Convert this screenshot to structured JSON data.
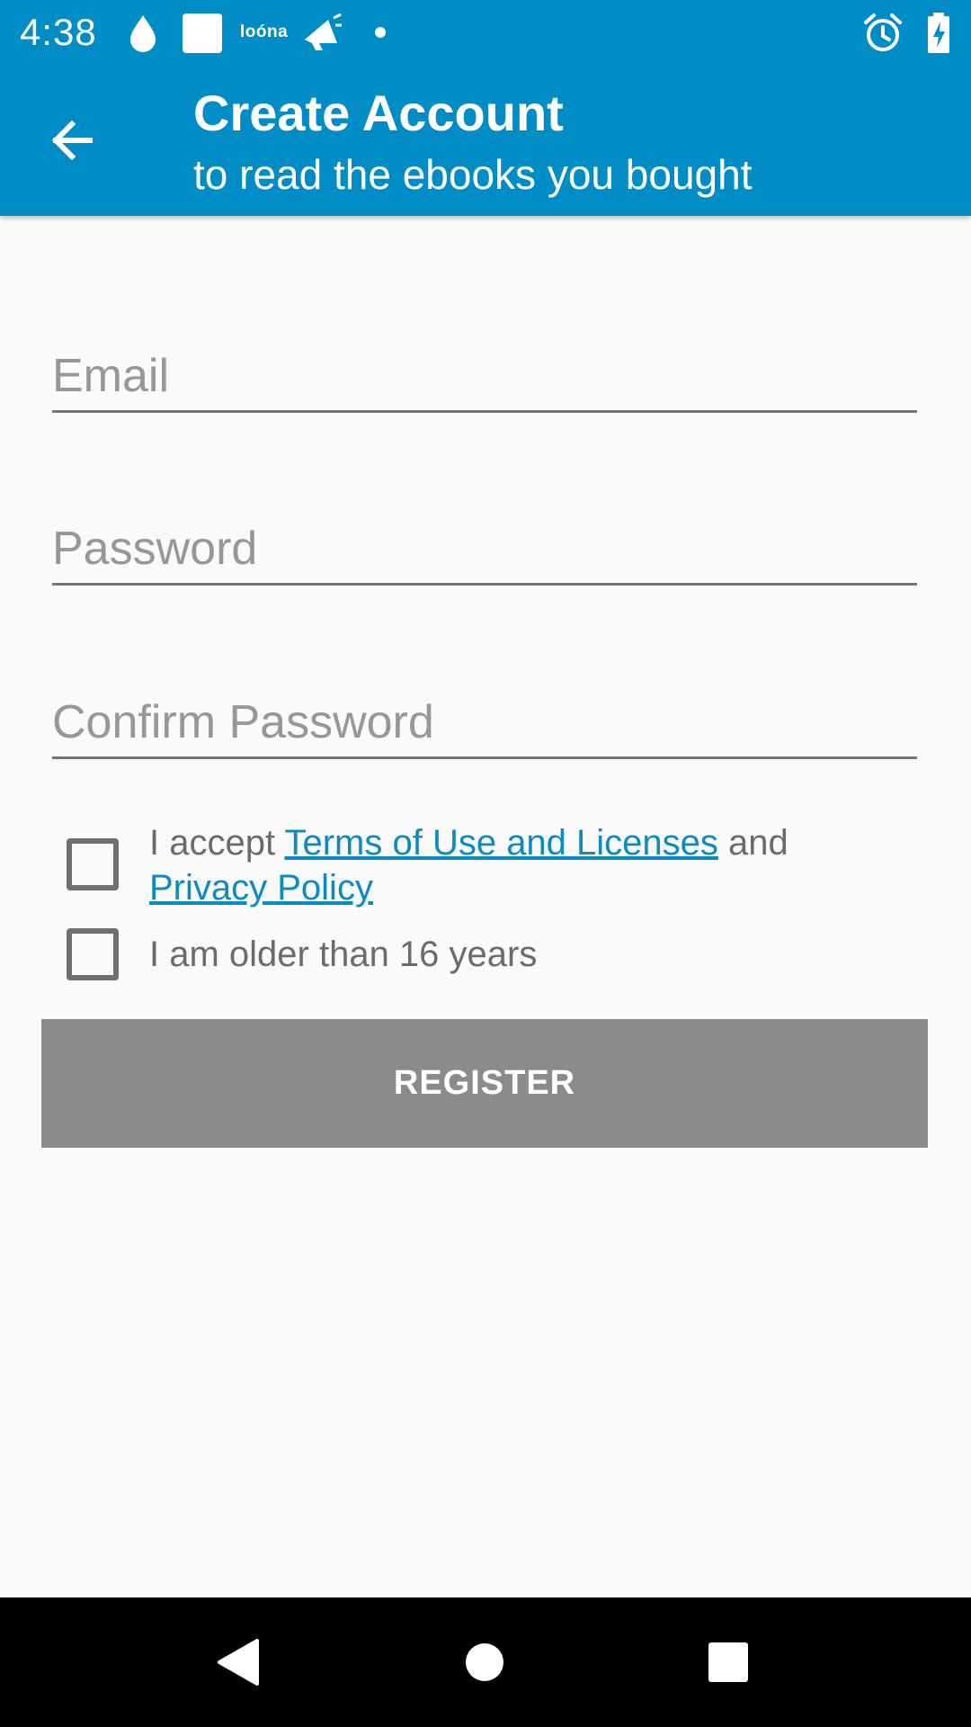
{
  "status_bar": {
    "time": "4:38",
    "notification_icons": [
      "water-drop-icon",
      "square-app-icon",
      "loona-app-icon",
      "megaphone-icon",
      "dot-icon"
    ],
    "brand_text": "loóna",
    "right_icons": [
      "alarm-icon",
      "battery-charging-icon"
    ]
  },
  "app_bar": {
    "title": "Create Account",
    "subtitle": "to read the ebooks you bought",
    "back_icon": "arrow-left-icon",
    "color": "#008dc6"
  },
  "form": {
    "email": {
      "value": "",
      "placeholder": "Email"
    },
    "password": {
      "value": "",
      "placeholder": "Password"
    },
    "confirm_password": {
      "value": "",
      "placeholder": "Confirm Password"
    }
  },
  "checkboxes": {
    "terms": {
      "checked": false,
      "prefix": "I accept ",
      "terms_link": "Terms of Use and Licenses",
      "middle": " and",
      "privacy_link": "Privacy Policy"
    },
    "age": {
      "checked": false,
      "label": "I am older than 16 years"
    }
  },
  "register_button": {
    "label": "REGISTER",
    "color": "#8b8b8b"
  },
  "nav_bar": {
    "icons": [
      "back-triangle-icon",
      "home-circle-icon",
      "recents-square-icon"
    ]
  },
  "colors": {
    "primary": "#008dc6",
    "link": "#0b8bc3",
    "background": "#fafafa"
  }
}
